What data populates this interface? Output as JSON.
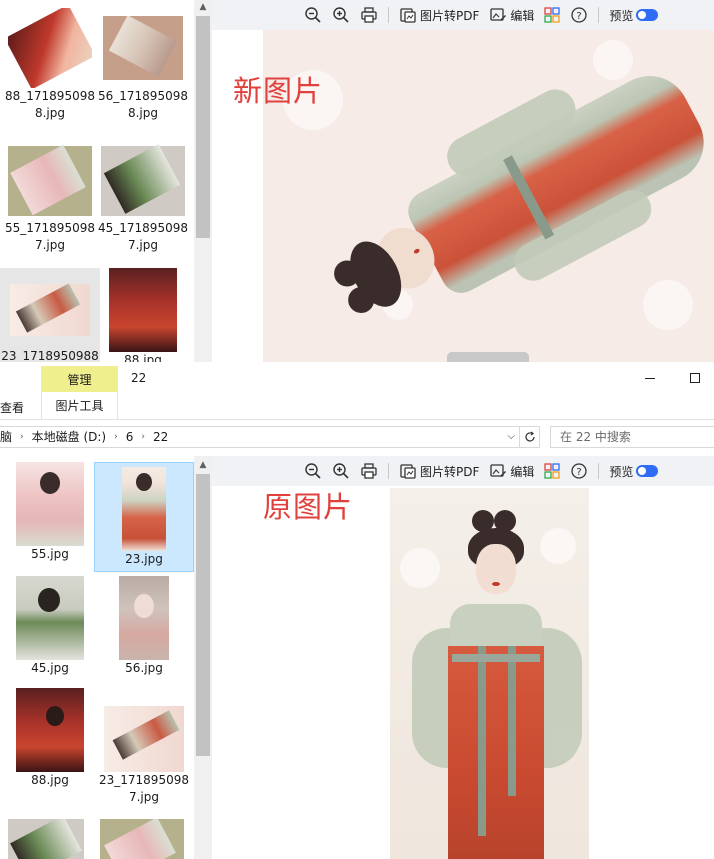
{
  "top_window": {
    "files": [
      {
        "name": "88_1718950988.jpg"
      },
      {
        "name": "56_1718950988.jpg"
      },
      {
        "name": "55_1718950987.jpg"
      },
      {
        "name": "45_1718950987.jpg"
      },
      {
        "name": "23_1718950988",
        "truncated": true
      },
      {
        "name": "88.jpg"
      }
    ],
    "overlay_label": "新图片"
  },
  "ribbon": {
    "tab_manage": "管理",
    "window_title": "22",
    "tab_view": "查看",
    "tab_picture_tools": "图片工具"
  },
  "address_bar": {
    "root_fragment": "脑",
    "drive": "本地磁盘 (D:)",
    "folder1": "6",
    "folder2": "22",
    "search_placeholder": "在 22 中搜索"
  },
  "bottom_window": {
    "files": [
      {
        "name": "55.jpg"
      },
      {
        "name": "23.jpg",
        "selected": true
      },
      {
        "name": "45.jpg"
      },
      {
        "name": "56.jpg"
      },
      {
        "name": "88.jpg"
      },
      {
        "name": "23_1718950987.jpg"
      }
    ],
    "overlay_label": "原图片"
  },
  "preview_toolbar": {
    "convert_pdf": "图片转PDF",
    "edit": "编辑",
    "preview": "预览",
    "icons": [
      "zoom-out-icon",
      "zoom-in-icon",
      "print-icon",
      "pdf-convert-icon",
      "edit-image-icon",
      "apps-grid-icon",
      "help-icon",
      "preview-toggle"
    ]
  },
  "window_controls": {
    "minimize": "—",
    "maximize": "☐"
  },
  "colors": {
    "accent_red": "#e0413d",
    "selection": "#cce8ff",
    "toggle_blue": "#2f6df6",
    "toolbar_bg": "#f0f2f5",
    "ribbon_highlight": "#f0ef8d"
  }
}
